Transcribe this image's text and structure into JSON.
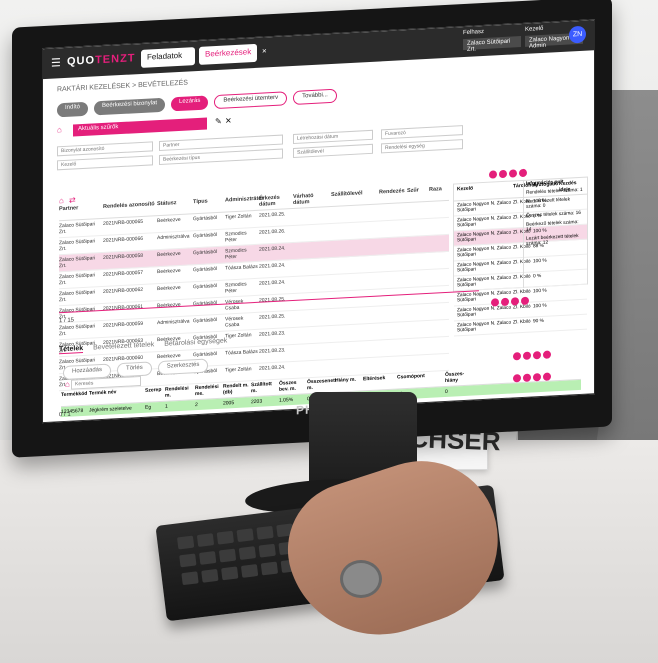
{
  "app": {
    "logo_text": "QUO",
    "logo_highlight": "TENZT",
    "tabs": [
      "Feladatok",
      "Beérkezések"
    ],
    "user_label_1": "Felhasz",
    "user_value_1": "Zalaco Sütőipari Zrt.",
    "user_label_2": "Kezelő",
    "user_value_2": "Zalaco Nagyon Admin",
    "avatar": "ZN"
  },
  "screen": {
    "breadcrumb": "RAKTÁRI KEZELÉSEK > BEVÉTELEZÉS",
    "pills": [
      "Indító",
      "Beérkezési bizonylat",
      "Lezárás",
      "Beérkezési ütemterv",
      "További..."
    ],
    "view_select": "Aktuális szűrők",
    "filter_fields": [
      "Bizonylat azonosító",
      "Partner",
      "Létrehozási dátum",
      "Fuvarozó",
      "Kezelő",
      "Beérkezési típus",
      "Szállítólevél",
      "Rendelési egység"
    ],
    "table_headers": [
      "Partner",
      "Rendelés azonosító",
      "Státusz",
      "Típus",
      "Adminisztrátor",
      "Érkezés dátum",
      "Várható dátum",
      "Szállítólevél",
      "Rendezés",
      "Szűr",
      "Raza"
    ],
    "rows": [
      [
        "Zalaco Sütőipari Zrt.",
        "2021NRB-000065",
        "Beérkezve",
        "Gyártásból",
        "Tiger Zoltán",
        "2021.08.25."
      ],
      [
        "Zalaco Sütőipari Zrt.",
        "2021NRB-000066",
        "Adminisztrálva",
        "Gyártásból",
        "Szmodics Péter",
        "2021.08.26."
      ],
      [
        "Zalaco Sütőipari Zrt.",
        "2021NRB-000058",
        "Beérkezve",
        "Gyártásból",
        "Szmodics Péter",
        "2021.08.24."
      ],
      [
        "Zalaco Sütőipari Zrt.",
        "2021NRB-000057",
        "Beérkezve",
        "Gyártásból",
        "Tóásza Balázs",
        "2021.08.24."
      ],
      [
        "Zalaco Sütőipari Zrt.",
        "2021NRB-000062",
        "Beérkezve",
        "Gyártásból",
        "Szmodics Péter",
        "2021.08.24."
      ],
      [
        "Zalaco Sütőipari Zrt.",
        "2021NRB-000061",
        "Beérkezve",
        "Gyártásból",
        "Vérosek Csaba",
        "2021.08.25."
      ],
      [
        "Zalaco Sütőipari Zrt.",
        "2021NRB-000059",
        "Adminisztrálva",
        "Gyártásból",
        "Vérosek Csaba",
        "2021.08.25."
      ],
      [
        "Zalaco Sütőipari Zrt.",
        "2021NRB-000063",
        "Beérkezve",
        "Gyártásból",
        "Tiger Zoltán",
        "2021.08.23."
      ],
      [
        "Zalaco Sütőipari Zrt.",
        "2021NRB-000060",
        "Beérkezve",
        "Gyártásból",
        "Tóásza Balázs",
        "2021.08.23."
      ],
      [
        "Zalaco Sütőipari Zrt.",
        "2021NRB-000064",
        "Beérkezve",
        "Gyártásból",
        "Tiger Zoltán",
        "2021.08.24."
      ]
    ],
    "record_count": "1 / 15",
    "side_headers": [
      "Kezelő",
      "Tárolóhely",
      "Árufogadó",
      "Kezdés ideje"
    ],
    "side_rows": [
      [
        "Zalaco Nagyon N. Zalaco Sütőipari",
        "ZI. Kbiló",
        "100 %"
      ],
      [
        "Zalaco Nagyon N. Zalaco Sütőipari",
        "ZI. Kbiló",
        "0 %"
      ],
      [
        "Zalaco Nagyon N. Zalaco Sütőipari",
        "ZI. Kbiló",
        "100 %"
      ],
      [
        "Zalaco Nagyon N. Zalaco Sütőipari",
        "ZI. Kbiló",
        "88 %"
      ],
      [
        "Zalaco Nagyon N. Zalaco Sütőipari",
        "ZI. Kbiló",
        "100 %"
      ],
      [
        "Zalaco Nagyon N. Zalaco Sütőipari",
        "ZI. Kbiló",
        "0 %"
      ],
      [
        "Zalaco Nagyon N. Zalaco Sütőipari",
        "ZI. Kbiló",
        "100 %"
      ],
      [
        "Zalaco Nagyon N. Zalaco Sütőipari",
        "ZI. Kbiló",
        "100 %"
      ],
      [
        "Zalaco Nagyon N. Zalaco Sütőipari",
        "ZI. Kbiló",
        "90 %"
      ]
    ],
    "info_title": "Információs pult",
    "info_rows": [
      "Rendelés tételek száma: 1",
      "Nem érkezett tételek száma: 0",
      "Összes tételek száma: 16",
      "Beérkező tételek száma: 14",
      "Lezárt beérkezett tételek száma: 12"
    ],
    "bottom_tabs": [
      "Tételek",
      "Bevételezett tételek",
      "Betárolási egységek"
    ],
    "sub_pills": [
      "Hozzáadás",
      "Törlés",
      "Szerkesztés"
    ],
    "search_placeholder": "Keresés",
    "bottom_headers": [
      "Termékkód",
      "Termék név",
      "Szerep",
      "Rendelési m.",
      "Rendelési me.",
      "Rendelt m. (db)",
      "Szállított m.",
      "Összes bev. m.",
      "Összesenett m.",
      "Hiány m.",
      "Eltérések",
      "Csomópont",
      "Összes-hiány"
    ],
    "bottom_row": [
      "12345678",
      "Jégkrém szeletelve",
      "Eg",
      "1",
      "2",
      "2005",
      "2203",
      "1.05%",
      "0",
      "10",
      "0",
      "10",
      "0"
    ],
    "bottom_count": "0 / 1"
  }
}
